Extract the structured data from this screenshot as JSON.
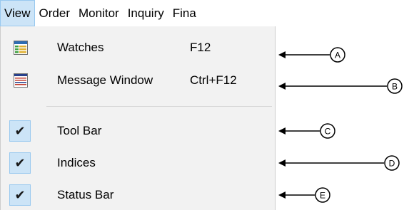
{
  "menubar": {
    "items": [
      {
        "label": "View",
        "active": true
      },
      {
        "label": "Order",
        "active": false
      },
      {
        "label": "Monitor",
        "active": false
      },
      {
        "label": "Inquiry",
        "active": false
      },
      {
        "label": "Fina",
        "active": false
      }
    ]
  },
  "view_menu": {
    "items": [
      {
        "label": "Watches",
        "shortcut": "F12",
        "icon": "watches-grid-icon"
      },
      {
        "label": "Message Window",
        "shortcut": "Ctrl+F12",
        "icon": "message-window-icon"
      },
      {
        "label": "Tool Bar",
        "shortcut": "",
        "checked": true
      },
      {
        "label": "Indices",
        "shortcut": "",
        "checked": true
      },
      {
        "label": "Status Bar",
        "shortcut": "",
        "checked": true
      }
    ],
    "check_glyph": "✔"
  },
  "callouts": [
    {
      "letter": "A"
    },
    {
      "letter": "B"
    },
    {
      "letter": "C"
    },
    {
      "letter": "D"
    },
    {
      "letter": "E"
    }
  ],
  "colors": {
    "menu_background": "#f2f2f2",
    "highlight": "#cce4f7",
    "highlight_border": "#99c9ef"
  }
}
